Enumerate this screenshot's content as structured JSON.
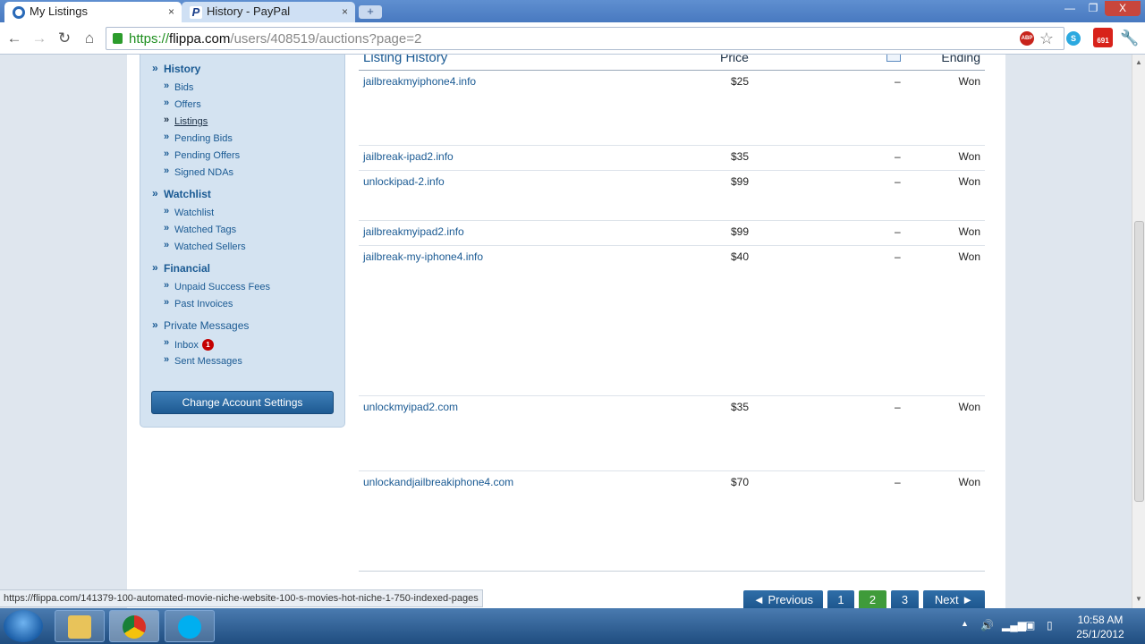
{
  "browser": {
    "tabs": [
      {
        "title": "My Listings",
        "close": "×"
      },
      {
        "title": "History - PayPal",
        "close": "×"
      }
    ],
    "new_tab": "+",
    "window_controls": [
      "—",
      "❐",
      "X"
    ],
    "url_https": "https://",
    "url_host": "flippa.com",
    "url_path": "/users/408519/auctions?page=2",
    "paypal_glyph": "P",
    "extensions": {
      "abp": "ABP",
      "gmail_count": "691"
    }
  },
  "sidebar": {
    "sections": [
      {
        "title": "History",
        "items": [
          "Bids",
          "Offers",
          "Listings",
          "Pending Bids",
          "Pending Offers",
          "Signed NDAs"
        ]
      },
      {
        "title": "Watchlist",
        "items": [
          "Watchlist",
          "Watched Tags",
          "Watched Sellers"
        ]
      },
      {
        "title": "Financial",
        "items": [
          "Unpaid Success Fees",
          "Past Invoices"
        ]
      },
      {
        "title": "Private Messages",
        "items": [
          "Inbox",
          "Sent Messages"
        ]
      }
    ],
    "active_item": "Listings",
    "inbox_badge": "1",
    "raquo": "»",
    "account_button": "Change Account Settings"
  },
  "table": {
    "headers": {
      "listing": "Listing History",
      "price": "Price",
      "ending": "Ending"
    },
    "rows": [
      {
        "name": "jailbreakmyiphone4.info",
        "price": "$25",
        "mail": "–",
        "ending": "Won"
      },
      {
        "name": "jailbreak-ipad2.info",
        "price": "$35",
        "mail": "–",
        "ending": "Won"
      },
      {
        "name": "unlockipad-2.info",
        "price": "$99",
        "mail": "–",
        "ending": "Won"
      },
      {
        "name": "jailbreakmyipad2.info",
        "price": "$99",
        "mail": "–",
        "ending": "Won"
      },
      {
        "name": "jailbreak-my-iphone4.info",
        "price": "$40",
        "mail": "–",
        "ending": "Won"
      },
      {
        "name": "unlockmyipad2.com",
        "price": "$35",
        "mail": "–",
        "ending": "Won"
      },
      {
        "name": "unlockandjailbreakiphone4.com",
        "price": "$70",
        "mail": "–",
        "ending": "Won"
      }
    ]
  },
  "pagination": {
    "previous": "◄ Previous",
    "pages": [
      "1",
      "2",
      "3"
    ],
    "current": "2",
    "next": "Next ►"
  },
  "status_url": "https://flippa.com/141379-100-automated-movie-niche-website-100-s-movies-hot-niche-1-750-indexed-pages",
  "taskbar": {
    "time": "10:58 AM",
    "date": "25/1/2012"
  }
}
